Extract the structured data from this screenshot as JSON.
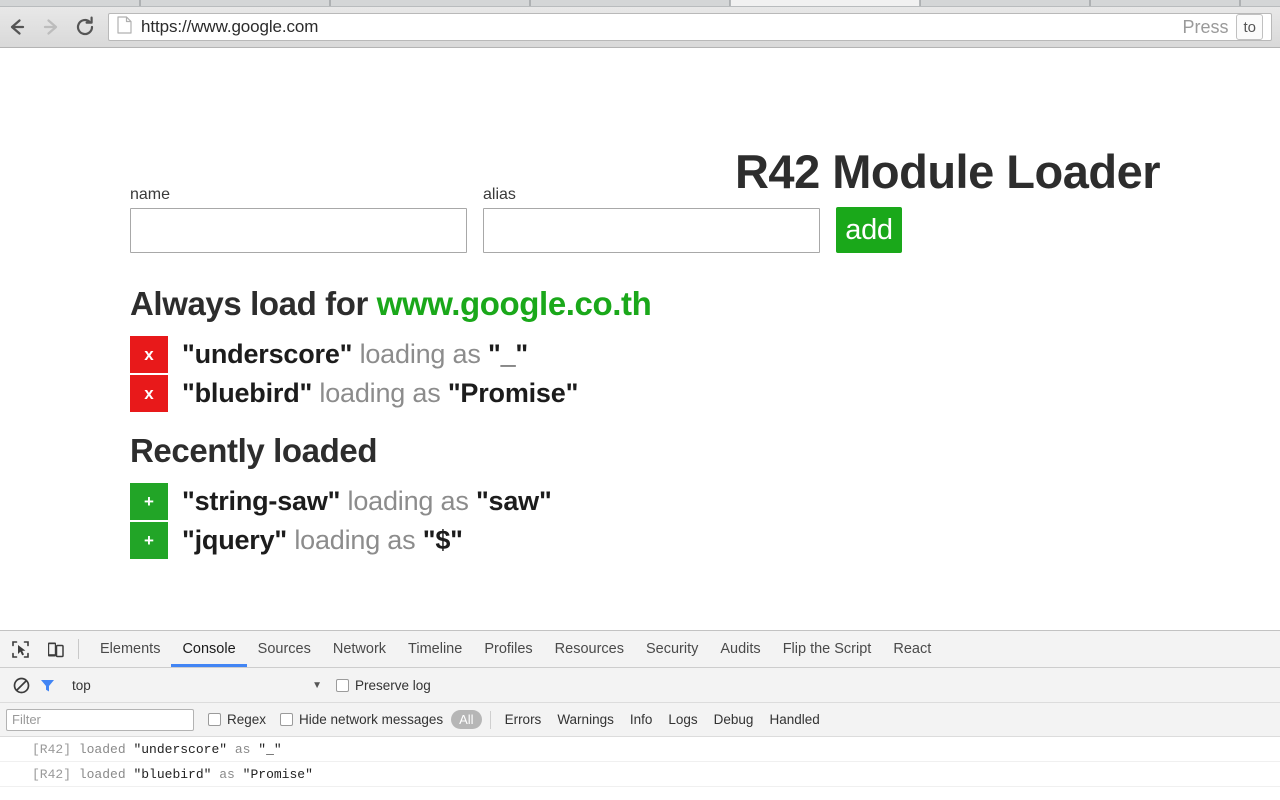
{
  "browser": {
    "back_icon": "back-arrow-icon",
    "forward_icon": "forward-arrow-icon",
    "reload_icon": "reload-icon",
    "page_icon": "document-icon",
    "url": "https://www.google.com",
    "press_label": "Press",
    "press_key": "to"
  },
  "page": {
    "title": "R42 Module Loader",
    "form": {
      "name_label": "name",
      "name_value": "",
      "name_placeholder": "",
      "alias_label": "alias",
      "alias_value": "",
      "alias_placeholder": "",
      "add_label": "add"
    },
    "always": {
      "heading_prefix": "Always load for ",
      "heading_domain": "www.google.co.th",
      "button_glyph": "x",
      "items": [
        {
          "name": "\"underscore\"",
          "verb": " loading as ",
          "alias": "\"_\""
        },
        {
          "name": "\"bluebird\"",
          "verb": " loading as ",
          "alias": "\"Promise\""
        }
      ]
    },
    "recent": {
      "heading": "Recently loaded",
      "button_glyph": "+",
      "items": [
        {
          "name": "\"string-saw\"",
          "verb": " loading as ",
          "alias": "\"saw\""
        },
        {
          "name": "\"jquery\"",
          "verb": " loading as ",
          "alias": "\"$\""
        }
      ]
    }
  },
  "devtools": {
    "inspect_icon": "inspect-element-icon",
    "device_icon": "device-toolbar-icon",
    "tabs": [
      {
        "label": "Elements",
        "active": false
      },
      {
        "label": "Console",
        "active": true
      },
      {
        "label": "Sources",
        "active": false
      },
      {
        "label": "Network",
        "active": false
      },
      {
        "label": "Timeline",
        "active": false
      },
      {
        "label": "Profiles",
        "active": false
      },
      {
        "label": "Resources",
        "active": false
      },
      {
        "label": "Security",
        "active": false
      },
      {
        "label": "Audits",
        "active": false
      },
      {
        "label": "Flip the Script",
        "active": false
      },
      {
        "label": "React",
        "active": false
      }
    ],
    "console_toolbar": {
      "clear_icon": "clear-console-icon",
      "filter_icon": "filter-funnel-icon",
      "context": "top",
      "context_caret": "▼",
      "preserve_log_label": "Preserve log",
      "preserve_log_checked": false
    },
    "filter_row": {
      "filter_placeholder": "Filter",
      "filter_value": "",
      "regex_label": "Regex",
      "regex_checked": false,
      "hide_network_label": "Hide network messages",
      "hide_network_checked": false,
      "all_label": "All",
      "levels": [
        "Errors",
        "Warnings",
        "Info",
        "Logs",
        "Debug",
        "Handled"
      ]
    },
    "messages": [
      {
        "tag": "[R42]",
        "verb": " loaded ",
        "name": "\"underscore\"",
        "as": " as ",
        "alias": "\"_\""
      },
      {
        "tag": "[R42]",
        "verb": " loaded ",
        "name": "\"bluebird\"",
        "as": " as ",
        "alias": "\"Promise\""
      }
    ]
  },
  "colors": {
    "green": "#1aa81a",
    "red": "#e8191a",
    "accent_blue": "#4285f4"
  }
}
